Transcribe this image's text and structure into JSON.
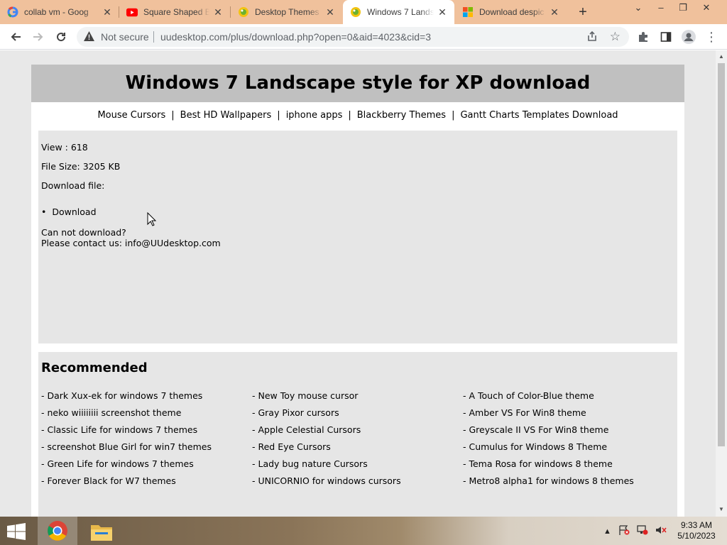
{
  "browser": {
    "tabs": [
      {
        "title": "collab vm - Goog",
        "icon": "google-icon"
      },
      {
        "title": "Square Shaped Bl",
        "icon": "youtube-icon"
      },
      {
        "title": "Desktop Themes",
        "icon": "uudesktop-icon"
      },
      {
        "title": "Windows 7 Lands",
        "icon": "uudesktop-icon"
      },
      {
        "title": "Download despic",
        "icon": "microsoft-icon"
      }
    ],
    "new_tab": "+",
    "security_label": "Not secure",
    "url": "uudesktop.com/plus/download.php?open=0&aid=4023&cid=3"
  },
  "page": {
    "title": "Windows 7 Landscape style for XP download",
    "nav": [
      "Mouse Cursors",
      "Best HD Wallpapers",
      "iphone apps",
      "Blackberry Themes",
      "Gantt Charts Templates Download"
    ],
    "nav_separator": "|",
    "info": {
      "view": "View : 618",
      "size": "File Size: 3205 KB",
      "download_file": "Download file:",
      "download_link": "Download",
      "cannot": "Can not download?",
      "contact": "Please contact us: info@UUdesktop.com"
    },
    "recommended": {
      "heading": "Recommended",
      "items": [
        "- Dark Xux-ek for windows 7 themes",
        "- New Toy mouse cursor",
        "- A Touch of Color-Blue theme",
        "- neko wiiiiiiii screenshot theme",
        "- Gray Pixor cursors",
        "- Amber VS For Win8 theme",
        "- Classic Life for windows 7 themes",
        "- Apple Celestial Cursors",
        "- Greyscale II VS For Win8 theme",
        "- screenshot Blue Girl for win7 themes",
        "- Red Eye Cursors",
        "- Cumulus for Windows 8 Theme",
        "- Green Life for windows 7 themes",
        "- Lady bug nature Cursors",
        "- Tema Rosa for windows 8 theme",
        "- Forever Black for W7 themes",
        "- UNICORNIO for windows cursors",
        "- Metro8 alpha1 for windows 8 themes"
      ]
    }
  },
  "taskbar": {
    "time": "9:33 AM",
    "date": "5/10/2023"
  },
  "colors": {
    "tabstrip": "#f0c19c",
    "header": "#c0c0c0",
    "content_box": "#e6e6e6"
  }
}
